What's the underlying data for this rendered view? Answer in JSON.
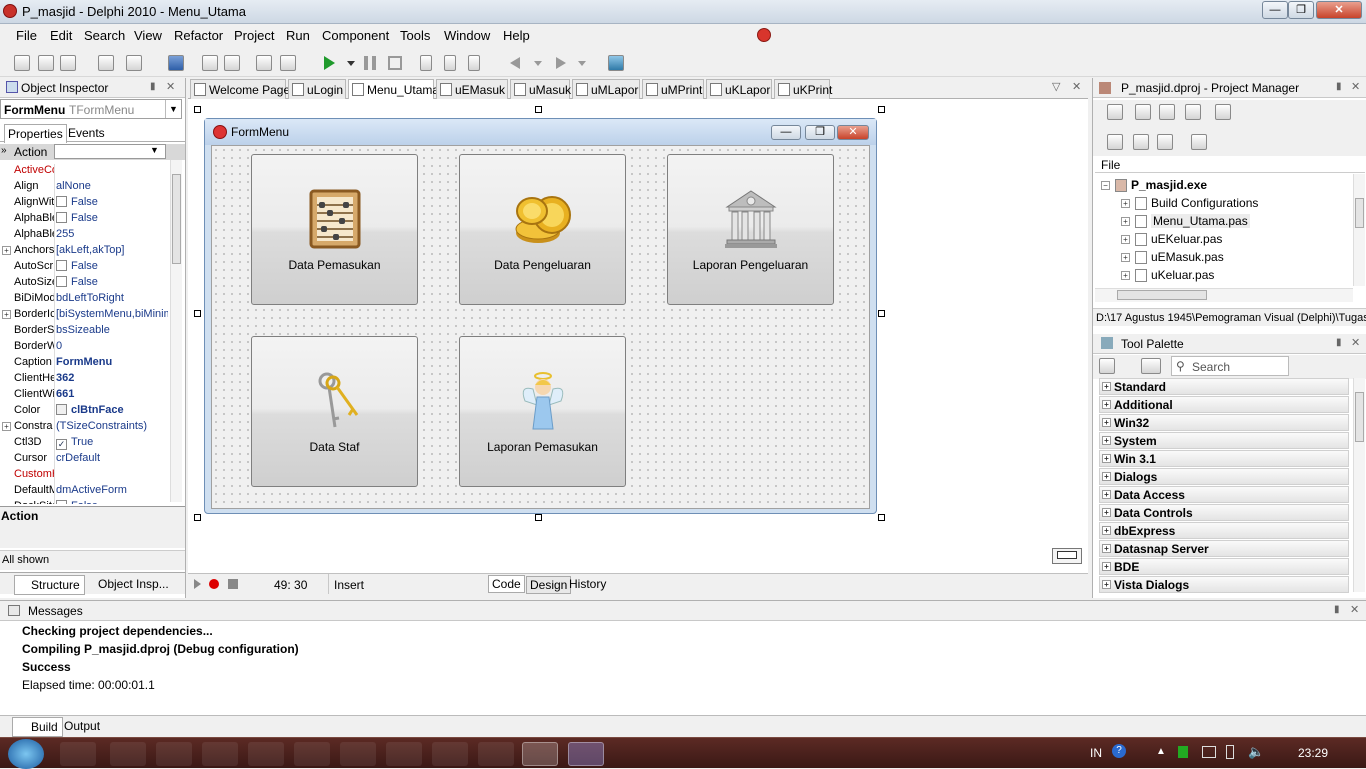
{
  "window": {
    "title": "P_masjid - Delphi 2010 - Menu_Utama"
  },
  "menu": [
    "File",
    "Edit",
    "Search",
    "View",
    "Refactor",
    "Project",
    "Run",
    "Component",
    "Tools",
    "Window",
    "Help"
  ],
  "object_inspector": {
    "title": "Object Inspector",
    "selected_name": "FormMenu",
    "selected_type": "TFormMenu",
    "tabs": [
      "Properties",
      "Events"
    ],
    "filter": "Action",
    "properties": [
      {
        "n": "ActiveCo",
        "v": "",
        "red": true
      },
      {
        "n": "Align",
        "v": "alNone"
      },
      {
        "n": "AlignWit",
        "v": "False",
        "cb": true
      },
      {
        "n": "AlphaBle",
        "v": "False",
        "cb": true
      },
      {
        "n": "AlphaBle",
        "v": "255"
      },
      {
        "n": "Anchors",
        "v": "[akLeft,akTop]",
        "exp": true
      },
      {
        "n": "AutoScr",
        "v": "False",
        "cb": true
      },
      {
        "n": "AutoSize",
        "v": "False",
        "cb": true
      },
      {
        "n": "BiDiMode",
        "v": "bdLeftToRight"
      },
      {
        "n": "BorderIc",
        "v": "[biSystemMenu,biMinim",
        "exp": true
      },
      {
        "n": "BorderS",
        "v": "bsSizeable"
      },
      {
        "n": "BorderW",
        "v": "0"
      },
      {
        "n": "Caption",
        "v": "FormMenu",
        "bold": true
      },
      {
        "n": "ClientHe",
        "v": "362",
        "bold": true
      },
      {
        "n": "ClientWi",
        "v": "661",
        "bold": true
      },
      {
        "n": "Color",
        "v": "clBtnFace",
        "bold": true,
        "swatch": true
      },
      {
        "n": "Constra",
        "v": "(TSizeConstraints)",
        "exp": true
      },
      {
        "n": "Ctl3D",
        "v": "True",
        "cb": true,
        "checked": true
      },
      {
        "n": "Cursor",
        "v": "crDefault"
      },
      {
        "n": "CustomH",
        "v": "",
        "red": true
      },
      {
        "n": "DefaultM",
        "v": "dmActiveForm"
      },
      {
        "n": "DockSite",
        "v": "False",
        "cb": true
      }
    ],
    "desc_title": "Action",
    "footer": "All shown",
    "bottom_tabs": [
      "Structure",
      "Object Insp..."
    ]
  },
  "editor": {
    "tabs": [
      "Welcome Page",
      "uLogin",
      "Menu_Utama",
      "uEMasuk",
      "uMasuk",
      "uMLapor",
      "uMPrint",
      "uKLapor",
      "uKPrint"
    ],
    "active_tab": 2,
    "form": {
      "caption": "FormMenu",
      "buttons": [
        {
          "label": "Data Pemasukan"
        },
        {
          "label": "Data Pengeluaran"
        },
        {
          "label": "Laporan Pengeluaran"
        },
        {
          "label": "Data Staf"
        },
        {
          "label": "Laporan Pemasukan"
        }
      ]
    },
    "status": {
      "position": "49:  30",
      "mode": "Insert",
      "view_tabs": [
        "Code",
        "Design",
        "History"
      ]
    }
  },
  "project_manager": {
    "title": "P_masjid.dproj - Project Manager",
    "column": "File",
    "tree": [
      {
        "label": "P_masjid.exe",
        "bold": true
      },
      {
        "label": "Build Configurations"
      },
      {
        "label": "Menu_Utama.pas"
      },
      {
        "label": "uEKeluar.pas"
      },
      {
        "label": "uEMasuk.pas"
      },
      {
        "label": "uKeluar.pas"
      }
    ],
    "path": "D:\\17 Agustus 1945\\Pemograman Visual (Delphi)\\Tugas_"
  },
  "tool_palette": {
    "title": "Tool Palette",
    "search_placeholder": "Search",
    "categories": [
      "Standard",
      "Additional",
      "Win32",
      "System",
      "Win 3.1",
      "Dialogs",
      "Data Access",
      "Data Controls",
      "dbExpress",
      "Datasnap Server",
      "BDE",
      "Vista Dialogs"
    ]
  },
  "messages": {
    "title": "Messages",
    "lines": [
      {
        "text": "Checking project dependencies...",
        "bold": true
      },
      {
        "text": "Compiling P_masjid.dproj (Debug configuration)",
        "bold": true
      },
      {
        "text": "Success",
        "bold": true
      },
      {
        "text": "Elapsed time: 00:00:01.1",
        "bold": false
      }
    ],
    "tabs": [
      "Build",
      "Output"
    ]
  },
  "taskbar": {
    "lang": "IN",
    "clock": "23:29"
  }
}
